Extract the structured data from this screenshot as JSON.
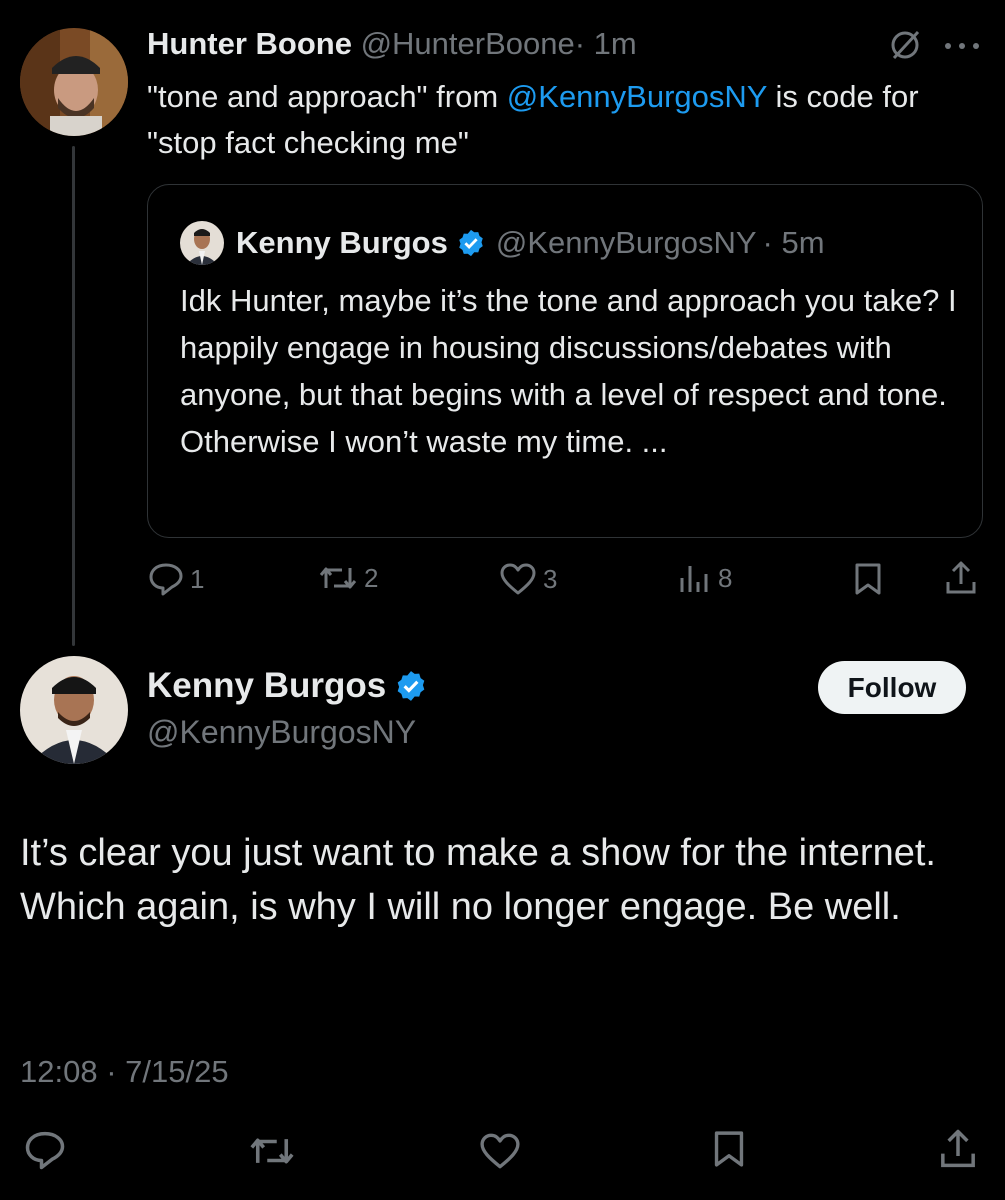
{
  "reply_tweet": {
    "author_name": "Hunter Boone",
    "author_handle": "@HunterBoone",
    "time": "· 1m",
    "text_before": "\"tone and approach\" from ",
    "mention": "@KennyBurgosNY",
    "text_after": " is code for \"stop fact checking me\"",
    "icons": [
      "grok-icon",
      "more-icon"
    ]
  },
  "quoted_tweet": {
    "author_name": "Kenny Burgos",
    "author_handle": "@KennyBurgosNY",
    "time": "· 5m",
    "text": "Idk Hunter, maybe it’s the tone and approach you take? I happily engage in housing discussions/debates with anyone, but that begins with a level of respect and tone. Otherwise I won’t waste my time. ..."
  },
  "reply_actions": {
    "replies": "1",
    "retweets": "2",
    "likes": "3",
    "views": "8"
  },
  "main_tweet": {
    "author_name": "Kenny Burgos",
    "author_handle": "@KennyBurgosNY",
    "follow_label": "Follow",
    "text": "It’s clear you just want to make a show for the internet. Which again, is why I will no longer engage. Be well.",
    "timestamp": "12:08 · 7/15/25"
  },
  "colors": {
    "background": "#000000",
    "text": "#e7e9ea",
    "muted": "#71767b",
    "accent": "#1d9bf0",
    "border": "#2f3336"
  }
}
